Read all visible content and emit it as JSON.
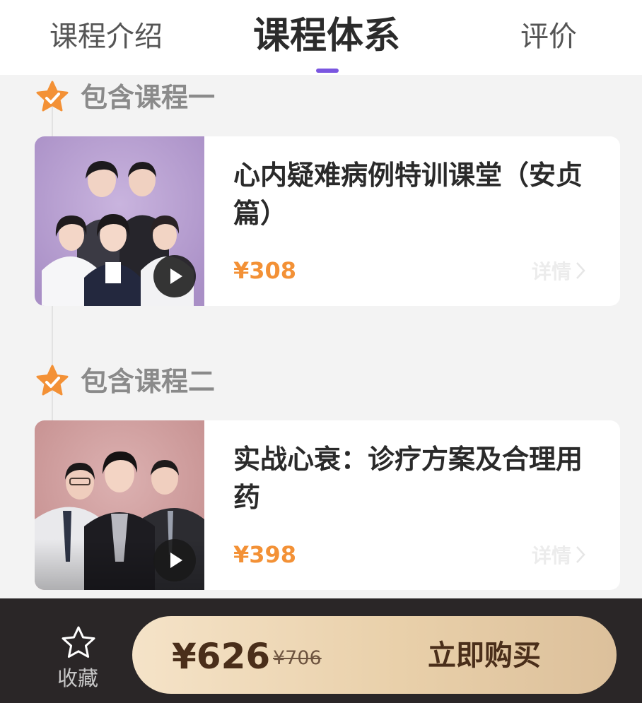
{
  "tabs": [
    {
      "label": "课程介绍",
      "active": false
    },
    {
      "label": "课程体系",
      "active": true
    },
    {
      "label": "评价",
      "active": false
    }
  ],
  "accent_color": "#7a56e0",
  "price_color": "#f39136",
  "sections": [
    {
      "heading": "包含课程一",
      "course": {
        "title": "心内疑难病例特训课堂（安贞篇）",
        "price": "¥308",
        "details_label": "详情",
        "thumb_bg": "#a98fc6"
      }
    },
    {
      "heading": "包含课程二",
      "course": {
        "title": "实战心衰：诊疗方案及合理用药",
        "price": "¥398",
        "details_label": "详情",
        "thumb_bg": "#c99595"
      }
    }
  ],
  "bottom_bar": {
    "favorite_label": "收藏",
    "total_price": "¥626",
    "original_price": "¥706",
    "buy_label": "立即购买"
  },
  "icons": [
    "star-check-icon",
    "play-icon",
    "chevron-right-icon",
    "star-outline-icon"
  ]
}
